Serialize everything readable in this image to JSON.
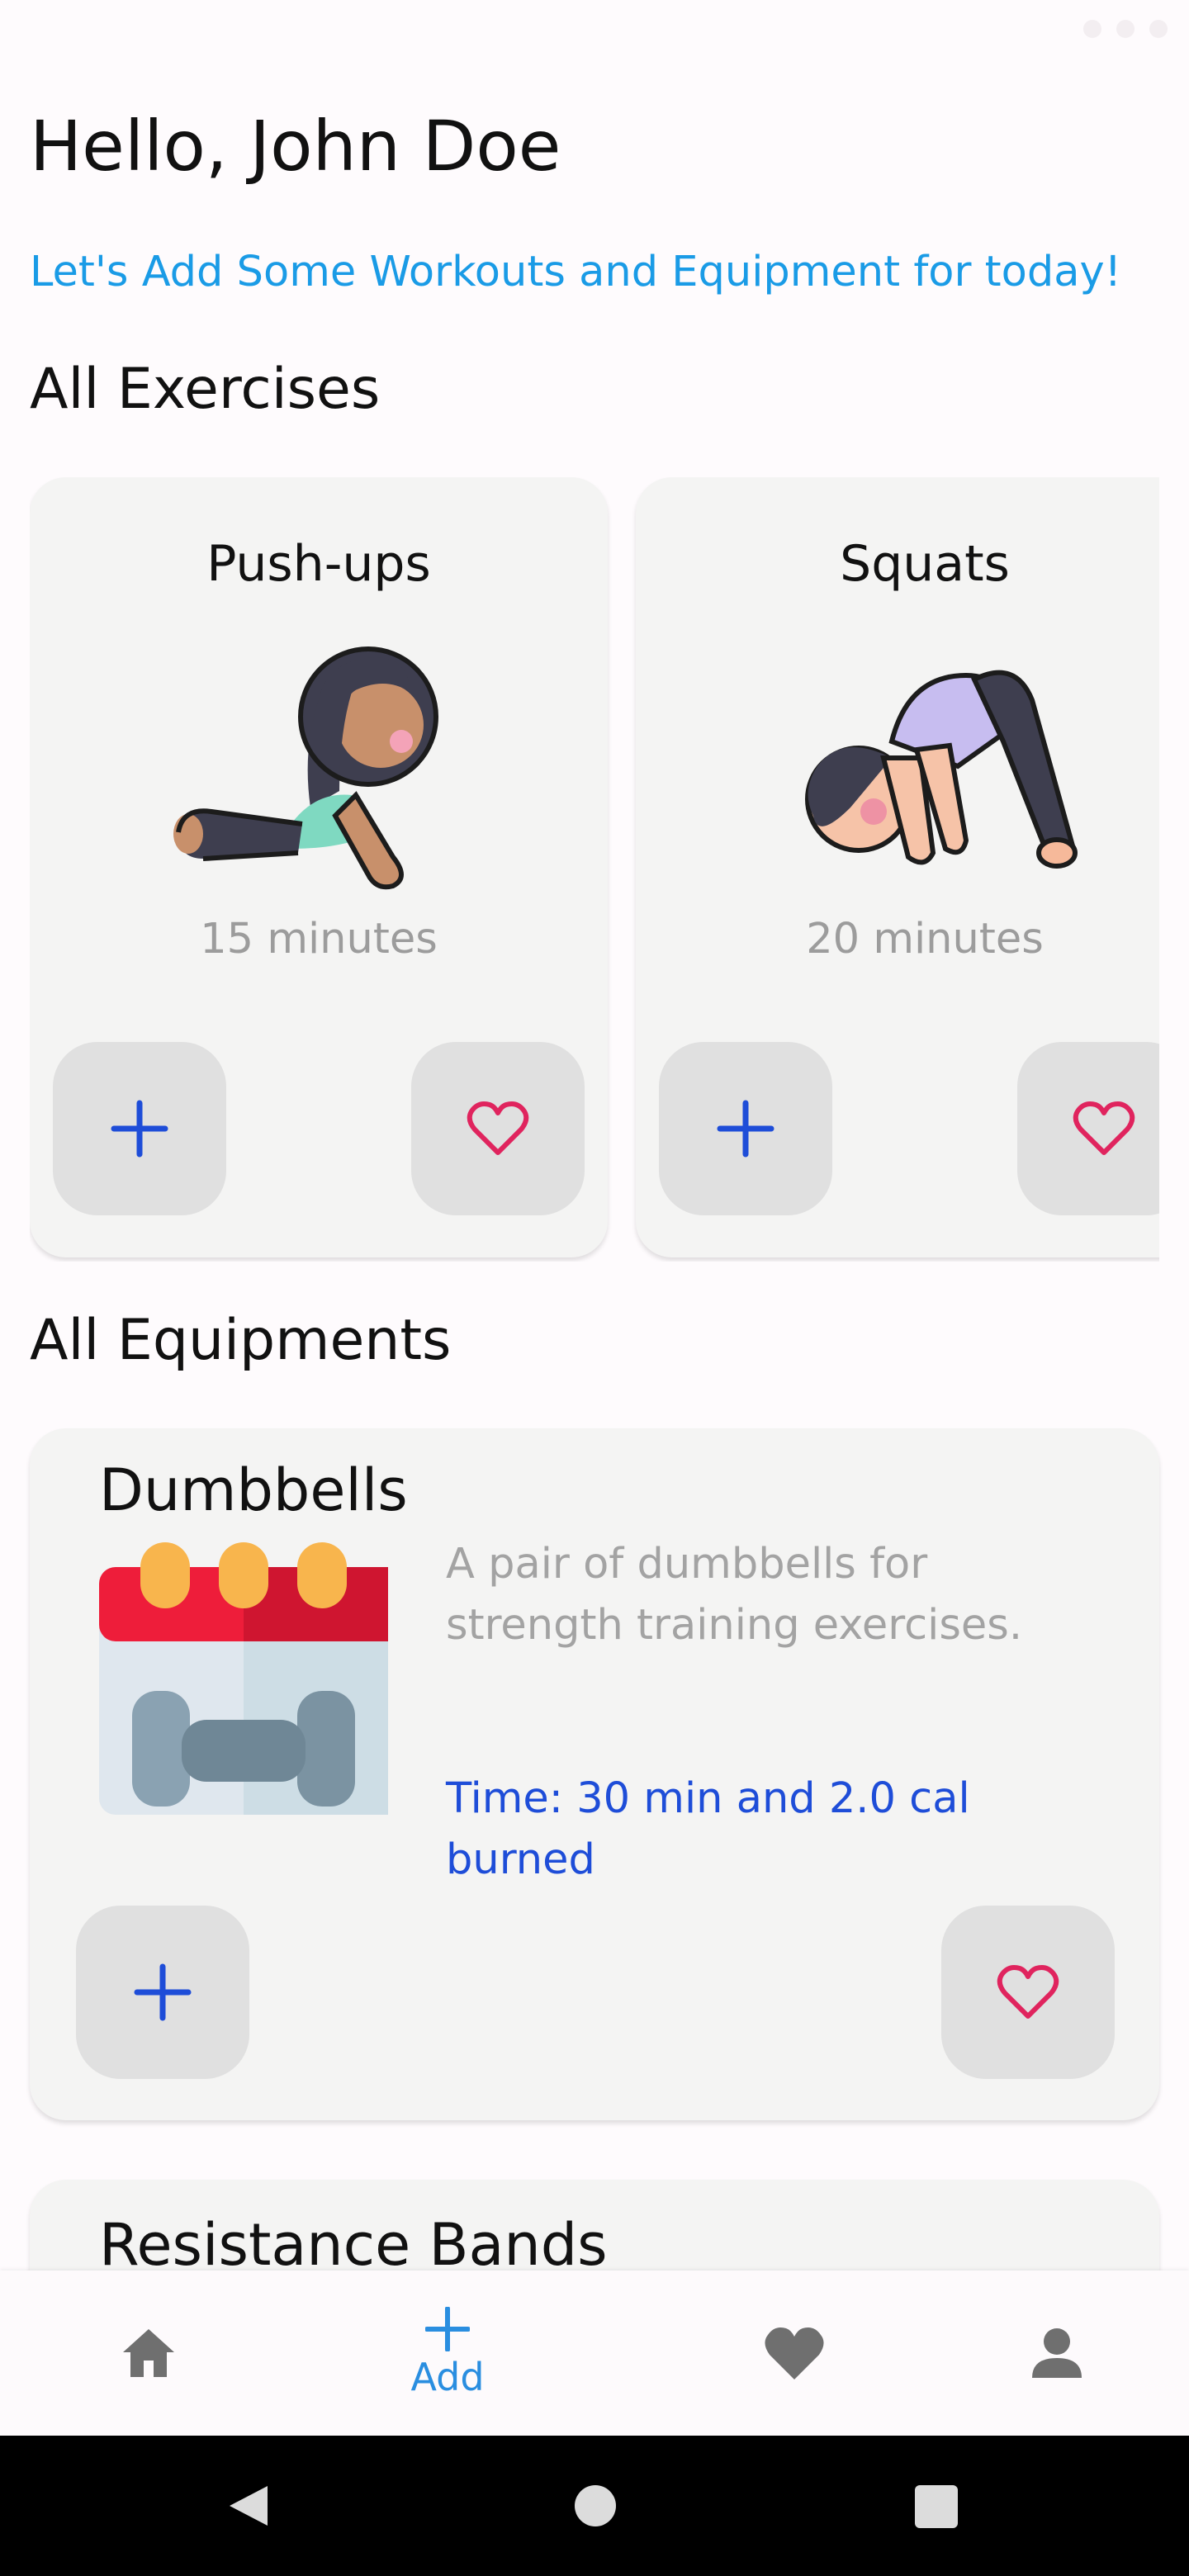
{
  "header": {
    "greeting": "Hello, John Doe",
    "subtitle": "Let's Add Some Workouts and Equipment for today!"
  },
  "sections": {
    "exercises_title": "All Exercises",
    "equipments_title": "All Equipments"
  },
  "exercises": [
    {
      "name": "Push-ups",
      "duration": "15 minutes"
    },
    {
      "name": "Squats",
      "duration": "20 minutes"
    }
  ],
  "equipments": [
    {
      "name": "Dumbbells",
      "description": "A pair of dumbbells for strength training exercises.",
      "time_line1": "Time: 30 min and 2.0 cal",
      "time_line2": "burned"
    },
    {
      "name": "Resistance Bands"
    }
  ],
  "bottom_nav": {
    "items": [
      {
        "icon": "home-icon"
      },
      {
        "icon": "plus-icon",
        "label": "Add",
        "active": true
      },
      {
        "icon": "heart-icon"
      },
      {
        "icon": "person-icon"
      }
    ]
  },
  "colors": {
    "accent": "#1a9be6",
    "add_icon": "#1e4dd8",
    "favorite_icon": "#e0245e",
    "card_bg": "#f4f4f3",
    "button_bg": "#e0e0e0",
    "muted_text": "#9c9c9c"
  }
}
